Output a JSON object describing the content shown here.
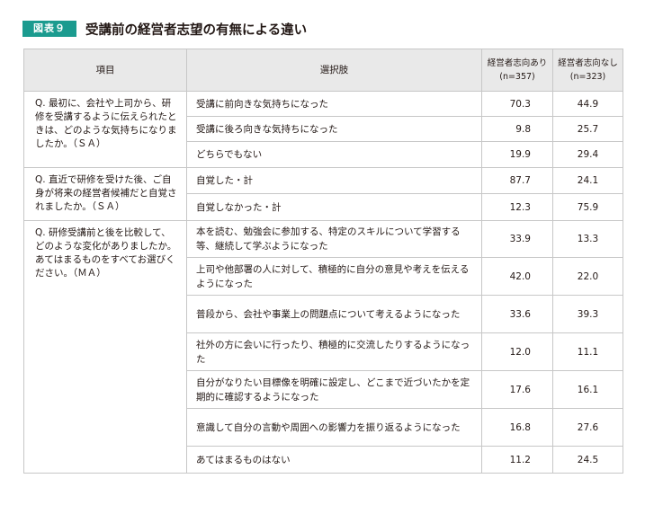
{
  "figure": {
    "badge": "図表９",
    "title": "受講前の経営者志望の有無による違い"
  },
  "table": {
    "headers": {
      "item": "項目",
      "option": "選択肢",
      "with_intent": "経営者志向あり",
      "with_intent_n": "(n=357)",
      "without_intent": "経営者志向なし",
      "without_intent_n": "(n=323)"
    },
    "questions": [
      {
        "question": "Q. 最初に、会社や上司から、研修を受講するように伝えられたときは、どのような気持ちになりましたか。（ＳＡ）",
        "rows": [
          {
            "option": "受講に前向きな気持ちになった",
            "with": "70.3",
            "without": "44.9"
          },
          {
            "option": "受講に後ろ向きな気持ちになった",
            "with": "9.8",
            "without": "25.7"
          },
          {
            "option": "どちらでもない",
            "with": "19.9",
            "without": "29.4"
          }
        ]
      },
      {
        "question": "Q. 直近で研修を受けた後、ご自身が将来の経営者候補だと自覚されましたか。（ＳＡ）",
        "rows": [
          {
            "option": "自覚した・計",
            "with": "87.7",
            "without": "24.1"
          },
          {
            "option": "自覚しなかった・計",
            "with": "12.3",
            "without": "75.9"
          }
        ]
      },
      {
        "question": "Q. 研修受講前と後を比較して、どのような変化がありましたか。あてはまるものをすべてお選びください。（ＭＡ）",
        "rows": [
          {
            "option": "本を読む、勉強会に参加する、特定のスキルについて学習する等、継続して学ぶようになった",
            "with": "33.9",
            "without": "13.3"
          },
          {
            "option": "上司や他部署の人に対して、積極的に自分の意見や考えを伝えるようになった",
            "with": "42.0",
            "without": "22.0"
          },
          {
            "option": "普段から、会社や事業上の問題点について考えるようになった",
            "with": "33.6",
            "without": "39.3"
          },
          {
            "option": "社外の方に会いに行ったり、積極的に交流したりするようになった",
            "with": "12.0",
            "without": "11.1"
          },
          {
            "option": "自分がなりたい目標像を明確に設定し、どこまで近づいたかを定期的に確認するようになった",
            "with": "17.6",
            "without": "16.1"
          },
          {
            "option": "意識して自分の言動や周囲への影響力を振り返るようになった",
            "with": "16.8",
            "without": "27.6"
          },
          {
            "option": "あてはまるものはない",
            "with": "11.2",
            "without": "24.5"
          }
        ]
      }
    ]
  }
}
